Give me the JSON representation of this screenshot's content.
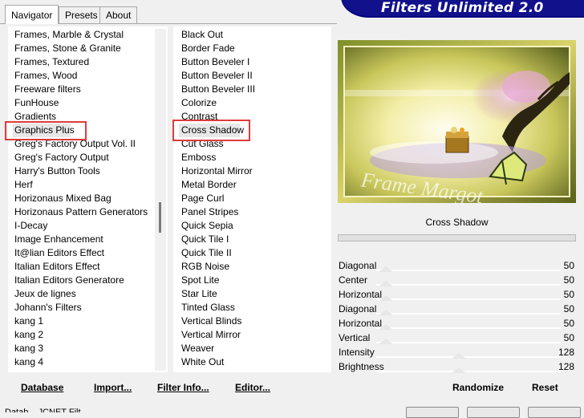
{
  "header": {
    "title": "Filters Unlimited 2.0"
  },
  "tabs": [
    {
      "label": "Navigator"
    },
    {
      "label": "Presets"
    },
    {
      "label": "About"
    }
  ],
  "categories": [
    "Frames, Marble & Crystal",
    "Frames, Stone & Granite",
    "Frames, Textured",
    "Frames, Wood",
    "Freeware filters",
    "FunHouse",
    "Gradients",
    "Graphics Plus",
    "Greg's Factory Output Vol. II",
    "Greg's Factory Output",
    "Harry's Button Tools",
    "Herf",
    "Horizonaus Mixed Bag",
    "Horizonaus Pattern Generators",
    "I-Decay",
    "Image Enhancement",
    "It@lian Editors Effect",
    "Italian Editors Effect",
    "Italian Editors Generatore",
    "Jeux de lignes",
    "Johann's Filters",
    "kang 1",
    "kang 2",
    "kang 3",
    "kang 4"
  ],
  "filters": [
    "Black Out",
    "Border Fade",
    "Button Beveler I",
    "Button Beveler II",
    "Button Beveler III",
    "Colorize",
    "Contrast",
    "Cross Shadow",
    "Cut Glass",
    "Emboss",
    "Horizontal Mirror",
    "Metal Border",
    "Page Curl",
    "Panel Stripes",
    "Quick Sepia",
    "Quick Tile I",
    "Quick Tile II",
    "RGB Noise",
    "Spot Lite",
    "Star Lite",
    "Tinted Glass",
    "Vertical Blinds",
    "Vertical Mirror",
    "Weaver",
    "White Out"
  ],
  "selected_category": "Graphics Plus",
  "selected_filter": "Cross Shadow",
  "preview": {
    "filter_name": "Cross Shadow",
    "watermark": "Frame Margot"
  },
  "settings": [
    {
      "label": "Diagonal",
      "value": "50"
    },
    {
      "label": "Center",
      "value": "50"
    },
    {
      "label": "Horizontal",
      "value": "50"
    },
    {
      "label": "Diagonal",
      "value": "50"
    },
    {
      "label": "Horizontal",
      "value": "50"
    },
    {
      "label": "Vertical",
      "value": "50"
    },
    {
      "label": "Intensity",
      "value": "128"
    },
    {
      "label": "Brightness",
      "value": "128"
    }
  ],
  "buttons": {
    "database": "Database",
    "import": "Import...",
    "filter_info": "Filter Info...",
    "editor": "Editor...",
    "randomize": "Randomize",
    "reset": "Reset"
  },
  "status": {
    "text": "Datab... JCNET Filt..."
  },
  "colors": {
    "banner": "#11118c",
    "highlight": "#e03b3b"
  }
}
